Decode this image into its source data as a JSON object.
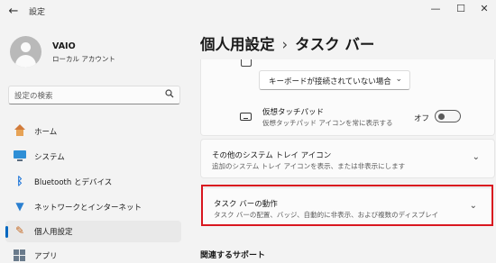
{
  "window": {
    "title": "設定",
    "back_glyph": "←",
    "minimize_glyph": "—",
    "maximize_glyph": "☐",
    "close_glyph": "✕"
  },
  "user": {
    "name": "VAIO",
    "account": "ローカル アカウント"
  },
  "search": {
    "placeholder": "設定の検索",
    "icon": "search-icon"
  },
  "sidebar": {
    "items": [
      {
        "label": "ホーム",
        "icon": "home-icon",
        "active": false
      },
      {
        "label": "システム",
        "icon": "system-icon",
        "active": false
      },
      {
        "label": "Bluetooth とデバイス",
        "icon": "bluetooth-icon",
        "active": false
      },
      {
        "label": "ネットワークとインターネット",
        "icon": "network-icon",
        "active": false
      },
      {
        "label": "個人用設定",
        "icon": "personalization-icon",
        "active": true
      },
      {
        "label": "アプリ",
        "icon": "apps-icon",
        "active": false
      }
    ]
  },
  "header": {
    "parent": "個人用設定",
    "separator": "›",
    "current": "タスク バー"
  },
  "keyboard_setting": {
    "dropdown_value": "キーボードが接続されていない場合"
  },
  "touchpad": {
    "title": "仮想タッチパッド",
    "description": "仮想タッチパッド アイコンを常に表示する",
    "toggle_label": "オフ",
    "toggle_on": false
  },
  "other_tray": {
    "title": "その他のシステム トレイ アイコン",
    "description": "追加のシステム トレイ アイコンを表示、または非表示にします"
  },
  "behaviors": {
    "title": "タスク バーの動作",
    "description": "タスク バーの配置、バッジ、自動的に非表示、および複数のディスプレイ"
  },
  "related": {
    "heading": "関連するサポート"
  },
  "colors": {
    "accent": "#0067c0",
    "highlight": "#d9171f",
    "background": "#f3f3f3",
    "card": "#fbfbfb"
  }
}
